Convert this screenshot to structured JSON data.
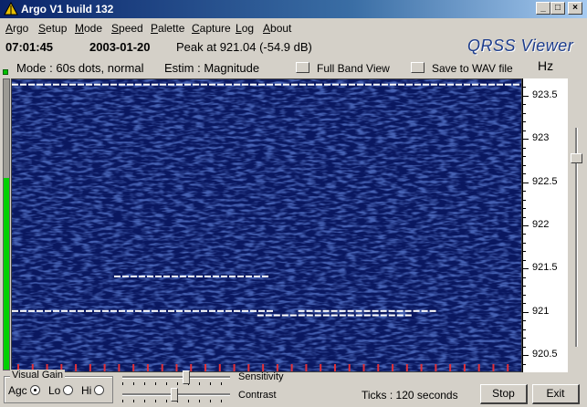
{
  "window": {
    "title": "Argo V1 build 132"
  },
  "menu": [
    "Argo",
    "Setup",
    "Mode",
    "Speed",
    "Palette",
    "Capture",
    "Log",
    "About"
  ],
  "info": {
    "time": "07:01:45",
    "date": "2003-01-20",
    "peak": "Peak at  921.04 (-54.9 dB)",
    "brand": "QRSS Viewer"
  },
  "status": {
    "mode": "Mode : 60s dots, normal",
    "estim": "Estim : Magnitude",
    "full_band_view": "Full Band View",
    "save_wav": "Save to WAV file",
    "unit": "Hz"
  },
  "axis": {
    "labels": [
      "923.5",
      "923",
      "922.5",
      "922",
      "921.5",
      "921",
      "920.5"
    ],
    "fmax": 923.7,
    "fmin": 920.3
  },
  "level_meter": {
    "fraction": 0.66
  },
  "spectrogram": {
    "colors": {
      "background": "#0a1860",
      "signal": "#ffffff",
      "tick": "#e0303a"
    },
    "signal_traces": [
      {
        "freq": 921.02,
        "t_start": 0.0,
        "t_end": 0.5
      },
      {
        "freq": 921.02,
        "t_start": 0.56,
        "t_end": 0.82
      },
      {
        "freq": 920.97,
        "t_start": 0.48,
        "t_end": 0.78
      },
      {
        "freq": 921.42,
        "t_start": 0.2,
        "t_end": 0.5
      },
      {
        "freq": 923.64,
        "t_start": 0.0,
        "t_end": 1.0
      }
    ],
    "tick_count": 36
  },
  "visual_gain": {
    "legend": "Visual Gain",
    "agc": "Agc",
    "lo": "Lo",
    "hi": "Hi",
    "selected": "Agc"
  },
  "controls": {
    "sensitivity_label": "Sensitivity",
    "contrast_label": "Contrast",
    "sensitivity_value": 0.6,
    "contrast_value": 0.48,
    "ticks_text": "Ticks   : 120 seconds",
    "stop_label": "Stop",
    "exit_label": "Exit"
  }
}
